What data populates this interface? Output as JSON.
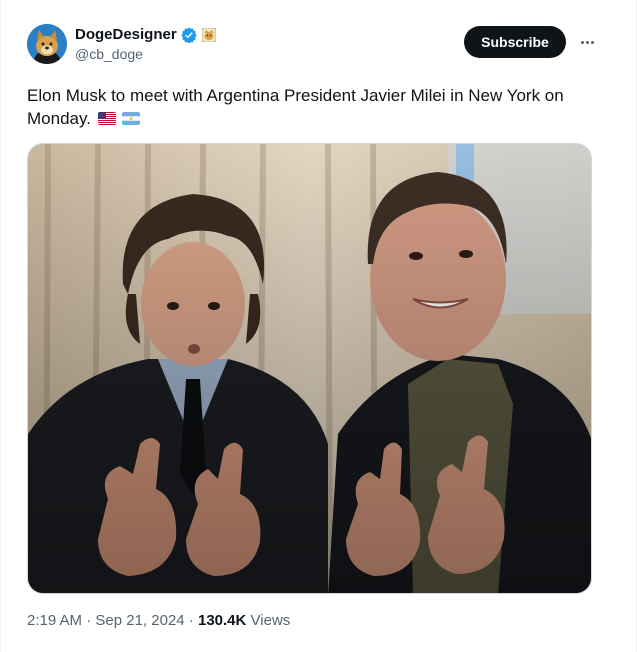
{
  "author": {
    "display_name": "DogeDesigner",
    "handle": "@cb_doge",
    "avatar_icon": "doge-avatar-icon",
    "verified_icon": "verified-badge-icon",
    "affiliation_icon": "doge-affiliate-icon"
  },
  "actions": {
    "subscribe_label": "Subscribe",
    "more_icon": "more-options-icon"
  },
  "tweet": {
    "text": "Elon Musk to meet with Argentina President Javier Milei in New York on Monday.",
    "emojis": [
      "us-flag-icon",
      "argentina-flag-icon"
    ]
  },
  "media": {
    "type": "photo"
  },
  "meta": {
    "time": "2:19 AM",
    "separator1": "·",
    "date": "Sep 21, 2024",
    "separator2": "·",
    "views_count": "130.4K",
    "views_label": "Views"
  },
  "colors": {
    "text_primary": "#0f1419",
    "text_secondary": "#536471",
    "verified_blue": "#1d9bf0",
    "button_bg": "#0f1419",
    "border": "#cfd9de"
  }
}
